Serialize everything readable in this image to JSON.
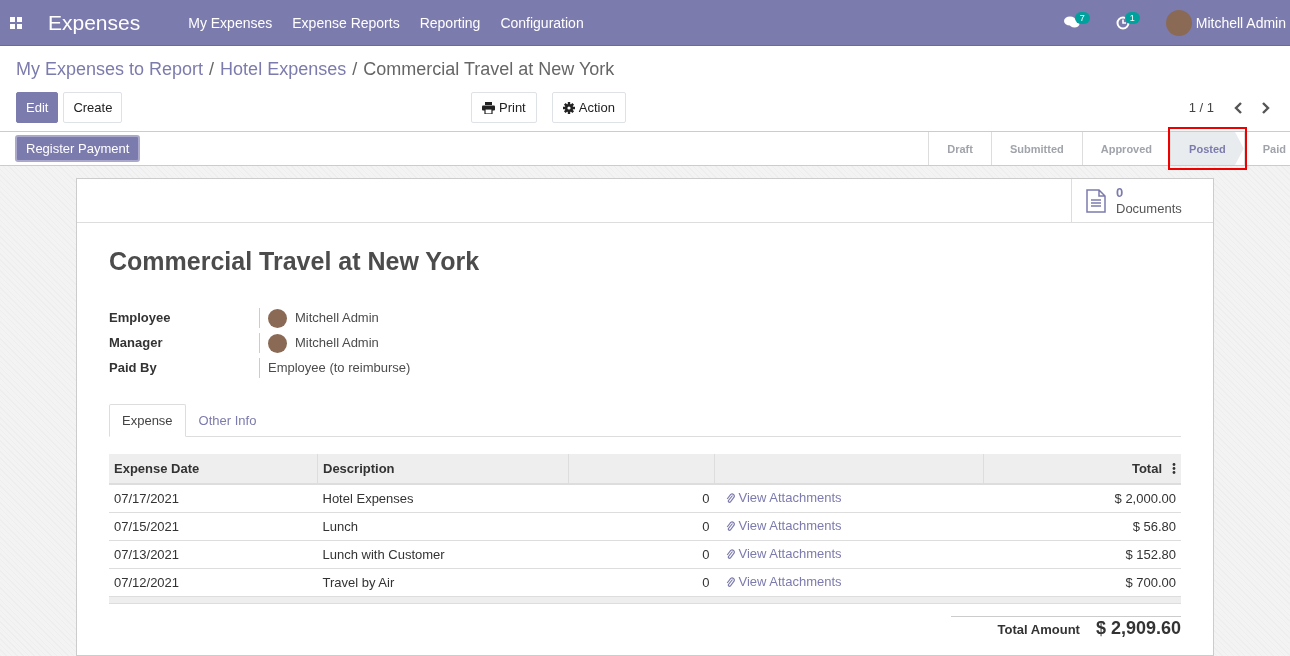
{
  "navbar": {
    "app_name": "Expenses",
    "menu": [
      "My Expenses",
      "Expense Reports",
      "Reporting",
      "Configuration"
    ],
    "messages_count": "7",
    "activities_count": "1",
    "user": "Mitchell Admin"
  },
  "breadcrumb": [
    {
      "label": "My Expenses to Report",
      "kind": "link"
    },
    {
      "label": "Hotel Expenses",
      "kind": "link",
      "separator": "/"
    },
    {
      "label": "Commercial Travel at New York",
      "kind": "current",
      "separator": "/"
    }
  ],
  "buttons": {
    "edit": "Edit",
    "create": "Create",
    "print": "Print",
    "action": "Action"
  },
  "pager": "1 / 1",
  "register_payment": "Register Payment",
  "stages": [
    {
      "label": "Draft",
      "selected": false
    },
    {
      "label": "Submitted",
      "selected": false
    },
    {
      "label": "Approved",
      "selected": false
    },
    {
      "label": "Posted",
      "selected": true
    },
    {
      "label": "Paid",
      "selected": false
    }
  ],
  "documents": {
    "count": "0",
    "label": "Documents"
  },
  "title": "Commercial Travel at New York",
  "fields": [
    {
      "label": "Employee",
      "value": "Mitchell Admin",
      "kind": "user"
    },
    {
      "label": "Manager",
      "value": "Mitchell Admin",
      "kind": "user"
    },
    {
      "label": "Paid By",
      "value": "Employee (to reimburse)",
      "kind": "text"
    }
  ],
  "tabs": [
    {
      "label": "Expense",
      "selected": true
    },
    {
      "label": "Other Info",
      "selected": false
    }
  ],
  "table": {
    "columns": [
      "Expense Date",
      "Description",
      "Total"
    ],
    "rows": [
      {
        "date": "07/17/2021",
        "description": "Hotel Expenses",
        "column_3": "0",
        "attachments": "View Attachments",
        "total": "$ 2,000.00"
      },
      {
        "date": "07/15/2021",
        "description": "Lunch",
        "column_3": "0",
        "attachments": "View Attachments",
        "total": "$ 56.80"
      },
      {
        "date": "07/13/2021",
        "description": "Lunch with Customer",
        "column_3": "0",
        "attachments": "View Attachments",
        "total": "$ 152.80"
      },
      {
        "date": "07/12/2021",
        "description": "Travel by Air",
        "column_3": "0",
        "attachments": "View Attachments",
        "total": "$ 700.00"
      }
    ]
  },
  "total": {
    "label": "Total Amount",
    "value": "$ 2,909.60"
  }
}
